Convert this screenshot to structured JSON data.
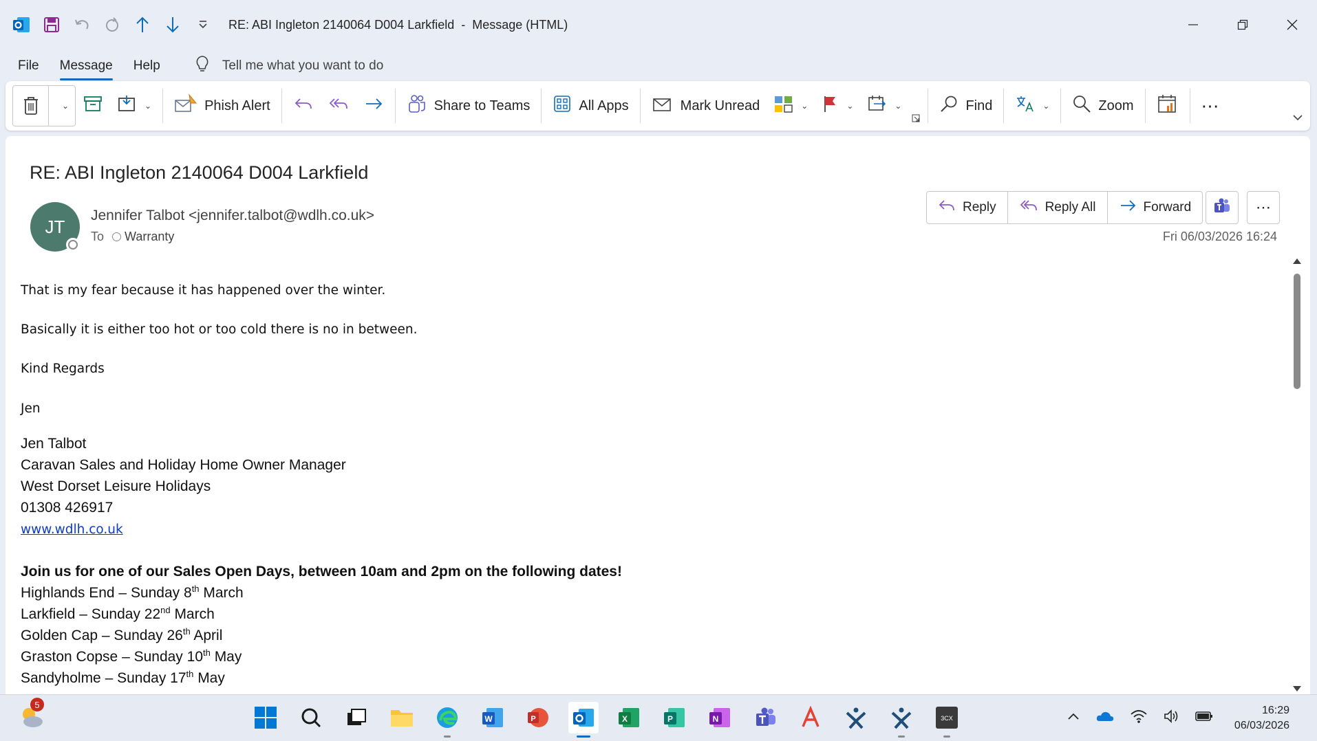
{
  "window": {
    "title": "RE: ABI Ingleton 2140064 D004 Larkfield  -  Message (HTML)"
  },
  "menu": {
    "items": [
      "File",
      "Message",
      "Help"
    ],
    "tellme": "Tell me what you want to do"
  },
  "ribbon": {
    "phish_alert": "Phish Alert",
    "share_to_teams": "Share to Teams",
    "all_apps": "All Apps",
    "mark_unread": "Mark Unread",
    "find": "Find",
    "zoom": "Zoom"
  },
  "message": {
    "subject": "RE: ABI Ingleton 2140064 D004 Larkfield",
    "avatar_initials": "JT",
    "sender": "Jennifer Talbot <jennifer.talbot@wdlh.co.uk>",
    "to_label": "To",
    "recipient": "Warranty",
    "datetime": "Fri 06/03/2026 16:24",
    "actions": {
      "reply": "Reply",
      "reply_all": "Reply All",
      "forward": "Forward"
    },
    "body": {
      "line1": "That is my fear because it has happened over the winter.",
      "line2": "Basically it is either too hot or too cold there is no in between.",
      "line3": "Kind Regards",
      "line4": "Jen"
    },
    "signature": {
      "name": "Jen Talbot",
      "role": "Caravan Sales and Holiday Home Owner Manager",
      "company": "West Dorset Leisure Holidays",
      "phone": "01308 426917",
      "website": "www.wdlh.co.uk",
      "open_days_heading": "Join us for one of our Sales Open Days, between 10am and 2pm on the following dates!",
      "dates": [
        {
          "pre": "Highlands End – Sunday 8",
          "sup": "th",
          "post": " March"
        },
        {
          "pre": "Larkfield – Sunday 22",
          "sup": "nd",
          "post": " March"
        },
        {
          "pre": "Golden Cap – Sunday 26",
          "sup": "th",
          "post": " April"
        },
        {
          "pre": "Graston Copse – Sunday 10",
          "sup": "th",
          "post": " May"
        },
        {
          "pre": "Sandyholme – Sunday 17",
          "sup": "th",
          "post": " May"
        }
      ]
    }
  },
  "taskbar": {
    "weather_badge": "5",
    "time": "16:29",
    "date": "06/03/2026"
  },
  "colors": {
    "accent": "#0f6cbd",
    "avatar": "#4c7b6e",
    "link": "#0b3cc5"
  }
}
